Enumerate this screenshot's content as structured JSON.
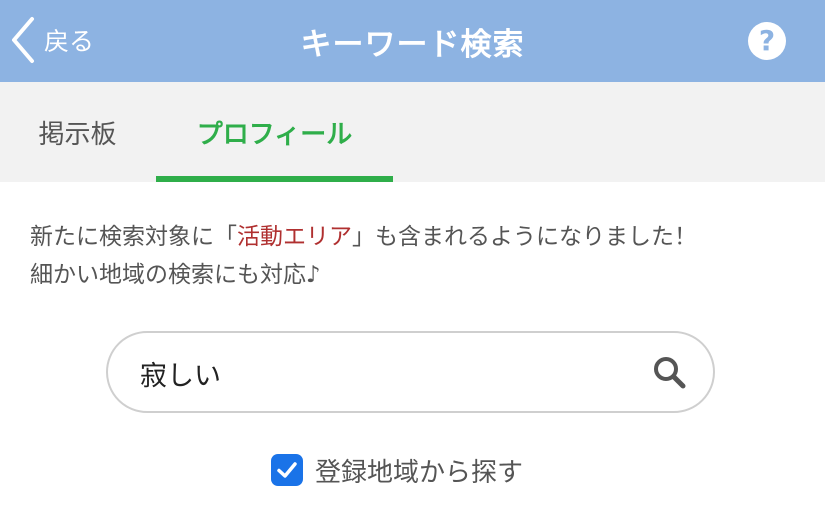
{
  "header": {
    "back_label": "戻る",
    "title": "キーワード検索",
    "help_icon": "?"
  },
  "tabs": [
    {
      "label": "掲示板",
      "active": false
    },
    {
      "label": "プロフィール",
      "active": true
    }
  ],
  "notice": {
    "before": "新たに検索対象に「",
    "highlight": "活動エリア",
    "after": "」も含まれるようになりました！",
    "line2": "細かい地域の検索にも対応♪"
  },
  "search": {
    "value": "寂しい",
    "icon": "search-icon"
  },
  "checkbox": {
    "label": "登録地域から探す",
    "checked": true
  },
  "colors": {
    "header": "#8db3e2",
    "tab_active": "#2fae4a",
    "highlight": "#b03030",
    "checkbox": "#1a73e8"
  }
}
